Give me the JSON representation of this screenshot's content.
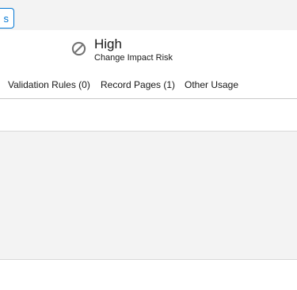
{
  "header": {
    "button_label": "s"
  },
  "risk": {
    "level": "High",
    "label": "Change Impact Risk",
    "icon": "prohibited-icon"
  },
  "tabs": [
    {
      "label": "Validation Rules (0)"
    },
    {
      "label": "Record Pages (1)"
    },
    {
      "label": "Other Usage"
    }
  ]
}
